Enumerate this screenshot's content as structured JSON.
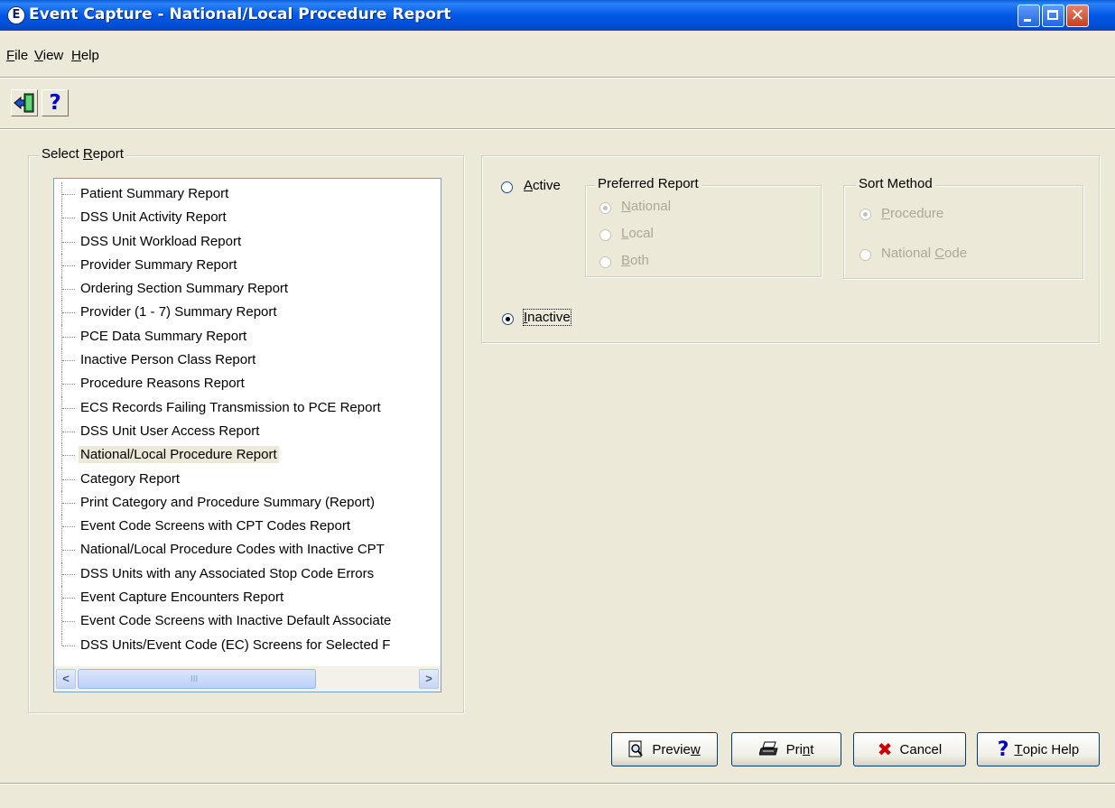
{
  "window": {
    "title": "Event Capture - National/Local Procedure Report",
    "app_icon_glyph": "E"
  },
  "menu": {
    "items": [
      {
        "label": "File",
        "accel": "F",
        "rest": "ile"
      },
      {
        "label": "View",
        "accel": "V",
        "rest": "iew"
      },
      {
        "label": "Help",
        "accel": "H",
        "rest": "elp"
      }
    ]
  },
  "toolbar": {
    "exit_icon": "exit-door-icon",
    "help_glyph": "?"
  },
  "select_report": {
    "group_label_prefix": "Select ",
    "group_label_accel": "R",
    "group_label_rest": "eport",
    "items": [
      "Patient Summary Report",
      "DSS Unit Activity Report",
      "DSS Unit Workload Report",
      "Provider Summary Report",
      "Ordering Section Summary Report",
      "Provider (1 - 7) Summary Report",
      "PCE Data Summary Report",
      "Inactive Person Class Report",
      "Procedure Reasons Report",
      "ECS Records Failing Transmission to PCE Report",
      "DSS Unit User Access Report",
      "National/Local Procedure Report",
      "Category Report",
      "Print Category and Procedure Summary (Report)",
      "Event Code Screens with CPT Codes Report",
      "National/Local Procedure Codes with Inactive CPT",
      "DSS Units with any Associated Stop Code Errors",
      "Event Capture Encounters Report",
      "Event Code Screens with Inactive Default Associate",
      "DSS Units/Event Code (EC) Screens for Selected F"
    ],
    "selected_index": 11,
    "scroll_grip": "III"
  },
  "options": {
    "active_accel": "A",
    "active_rest": "ctive",
    "inactive_accel": "I",
    "inactive_rest": "nactive",
    "status_selected": "Inactive",
    "preferred_report": {
      "label": "Preferred Report",
      "options": [
        {
          "accel": "N",
          "rest": "ational"
        },
        {
          "accel": "L",
          "rest": "ocal"
        },
        {
          "accel": "B",
          "rest": "oth"
        }
      ],
      "selected": "National"
    },
    "sort_method": {
      "label": "Sort Method",
      "procedure_accel": "P",
      "procedure_rest": "rocedure",
      "national_code_prefix": "National ",
      "national_code_accel": "C",
      "national_code_rest": "ode",
      "selected": "Procedure"
    }
  },
  "buttons": {
    "preview_prefix": "Previe",
    "preview_accel": "w",
    "print_prefix": "Pri",
    "print_accel": "n",
    "print_rest": "t",
    "cancel_label": "Cancel",
    "topic_help_accel": "T",
    "topic_help_rest": "opic Help",
    "help_glyph": "?",
    "cancel_glyph": "✖"
  }
}
